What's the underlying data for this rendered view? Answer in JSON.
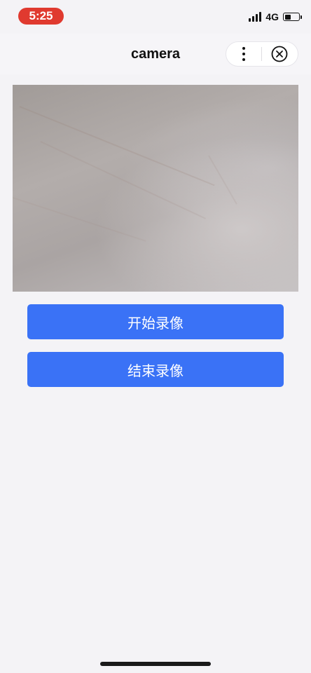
{
  "status_bar": {
    "time": "5:25",
    "time_pill_color": "#e03a2f",
    "network": "4G",
    "signal_bars": 4,
    "battery_level": 0.45
  },
  "nav": {
    "title": "camera",
    "more_icon": "more-dots-icon",
    "close_icon": "close-circle-icon"
  },
  "camera": {
    "preview": "live-camera-feed"
  },
  "buttons": {
    "start_label": "开始录像",
    "stop_label": "结束录像",
    "color": "#3a72f6"
  }
}
